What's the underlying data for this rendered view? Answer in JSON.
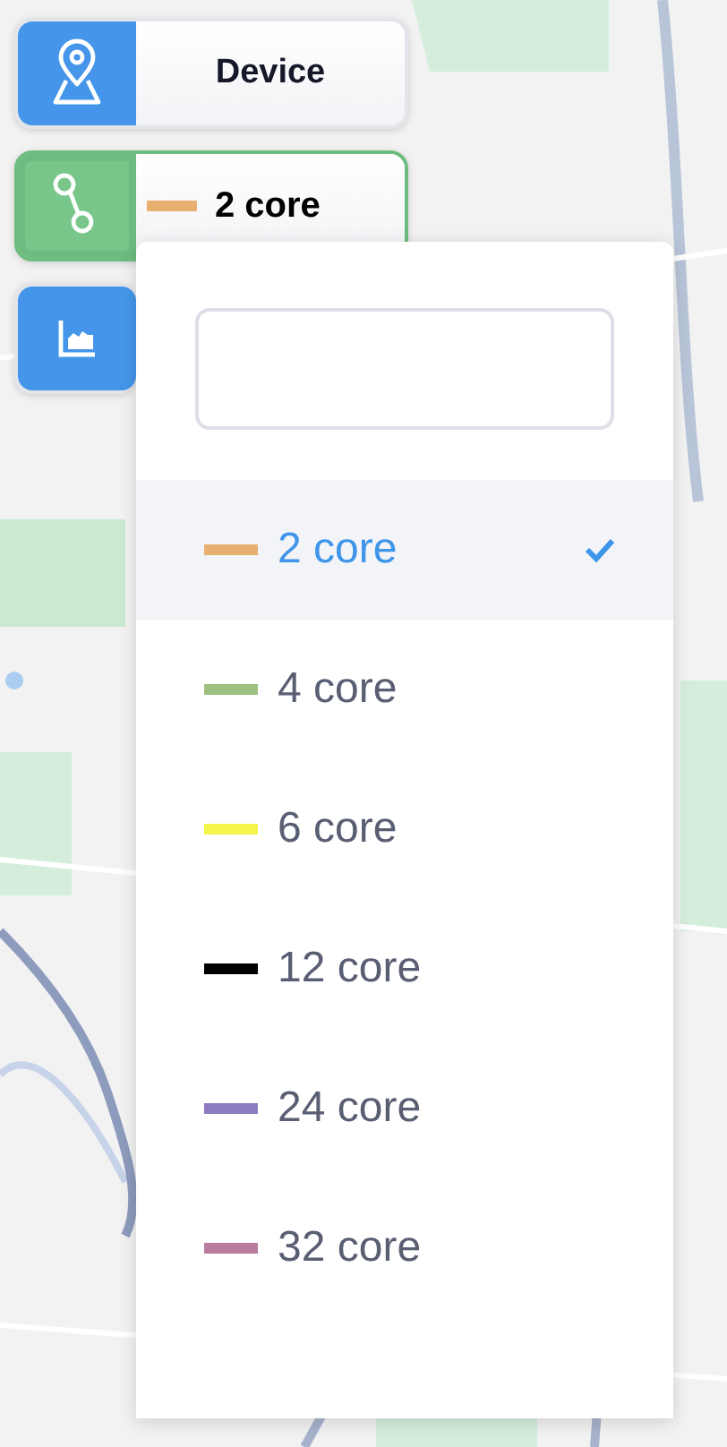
{
  "tools": [
    {
      "kind": "location",
      "active": false,
      "label": "Device"
    },
    {
      "kind": "route",
      "active": true,
      "label": "2 core",
      "color": "#e8b070"
    },
    {
      "kind": "chart",
      "active": false
    }
  ],
  "dropdown": {
    "options": [
      {
        "label": "2 core",
        "color": "#e8b070",
        "selected": true
      },
      {
        "label": "4 core",
        "color": "#9dc07f",
        "selected": false
      },
      {
        "label": "6 core",
        "color": "#f4f54a",
        "selected": false
      },
      {
        "label": "12 core",
        "color": "#000000",
        "selected": false
      },
      {
        "label": "24 core",
        "color": "#8c7cbf",
        "selected": false
      },
      {
        "label": "32 core",
        "color": "#b97c9f",
        "selected": false
      }
    ]
  }
}
